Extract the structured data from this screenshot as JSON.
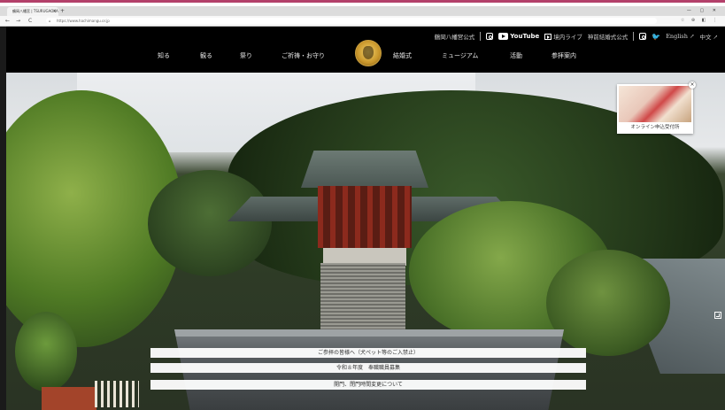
{
  "browser": {
    "tab_title": "鶴岡八幡宮 | TSURUGAOKA",
    "tab_close": "×",
    "new_tab": "+",
    "window_controls": "— ▢ ✕",
    "nav_back": "←",
    "nav_forward": "→",
    "nav_reload": "C",
    "url": "https://www.hachimangu.or.jp",
    "lock": "⌂",
    "toolbar_icons": "☆ ⊕ ◧ ⋮"
  },
  "header": {
    "top_links": [
      {
        "label": "鶴岡八幡宮公式"
      },
      {
        "label": "YouTube"
      },
      {
        "label": "境内ライブ"
      },
      {
        "label": "神前結婚式公式"
      },
      {
        "label": "English ↗"
      },
      {
        "label": "中文 ↗"
      }
    ],
    "twitter_glyph": "🐦",
    "main_nav": [
      {
        "label": "知る"
      },
      {
        "label": "観る"
      },
      {
        "label": "祭り"
      },
      {
        "label": "ご祈祷・お守り"
      },
      {
        "label": "結婚式"
      },
      {
        "label": "ミュージアム"
      },
      {
        "label": "活動"
      },
      {
        "label": "参拝案内"
      }
    ]
  },
  "promo": {
    "label": "オンライン申込受付所",
    "close": "×"
  },
  "notices": [
    {
      "text": "ご参拝の皆様へ（犬ペット等のご入禁止）"
    },
    {
      "text": "令和８年度　奉職職員募集"
    },
    {
      "text": "開門、閉門時間変更について"
    }
  ]
}
